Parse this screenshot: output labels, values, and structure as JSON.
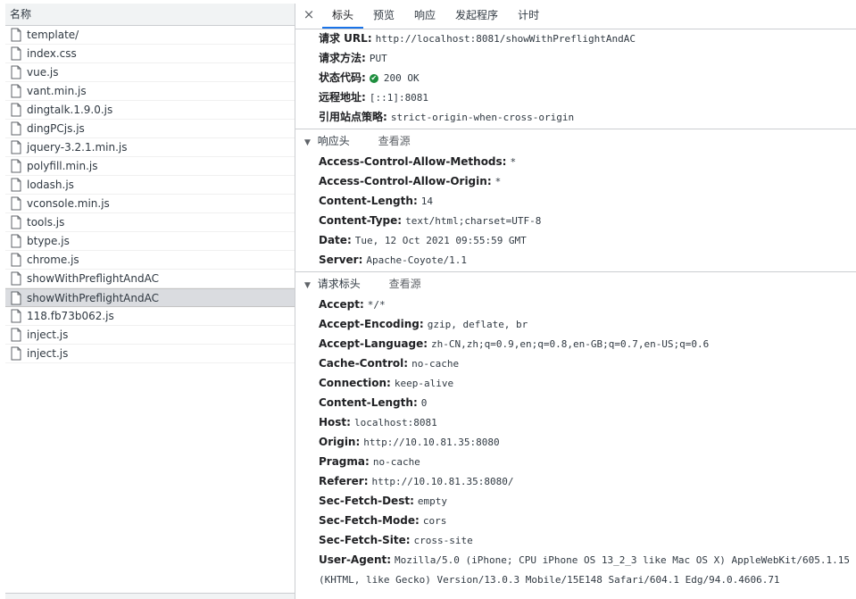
{
  "file_list": {
    "header": "名称",
    "selected_index": 15,
    "items": [
      "template/",
      "index.css",
      "vue.js",
      "vant.min.js",
      "dingtalk.1.9.0.js",
      "dingPCjs.js",
      "jquery-3.2.1.min.js",
      "polyfill.min.js",
      "lodash.js",
      "vconsole.min.js",
      "tools.js",
      "btype.js",
      "chrome.js",
      "showWithPreflightAndAC",
      "showWithPreflightAndAC",
      "118.fb73b062.js",
      "inject.js",
      "inject.js"
    ]
  },
  "tabs": {
    "close_label": "×",
    "items": [
      "标头",
      "预览",
      "响应",
      "发起程序",
      "计时"
    ],
    "active": 0
  },
  "general": [
    {
      "key": "请求 URL",
      "value": "http://localhost:8081/showWithPreflightAndAC"
    },
    {
      "key": "请求方法",
      "value": "PUT"
    },
    {
      "key": "状态代码",
      "value": "200 OK",
      "status_icon": "check-circle-icon",
      "status_color": "#1e8e3e"
    },
    {
      "key": "远程地址",
      "value": "[::1]:8081"
    },
    {
      "key": "引用站点策略",
      "value": "strict-origin-when-cross-origin"
    }
  ],
  "response_headers": {
    "title": "响应头",
    "view_source": "查看源",
    "items": [
      {
        "key": "Access-Control-Allow-Methods",
        "value": "*"
      },
      {
        "key": "Access-Control-Allow-Origin",
        "value": "*"
      },
      {
        "key": "Content-Length",
        "value": "14"
      },
      {
        "key": "Content-Type",
        "value": "text/html;charset=UTF-8"
      },
      {
        "key": "Date",
        "value": "Tue, 12 Oct 2021 09:55:59 GMT"
      },
      {
        "key": "Server",
        "value": "Apache-Coyote/1.1"
      }
    ]
  },
  "request_headers": {
    "title": "请求标头",
    "view_source": "查看源",
    "items": [
      {
        "key": "Accept",
        "value": "*/*"
      },
      {
        "key": "Accept-Encoding",
        "value": "gzip, deflate, br"
      },
      {
        "key": "Accept-Language",
        "value": "zh-CN,zh;q=0.9,en;q=0.8,en-GB;q=0.7,en-US;q=0.6"
      },
      {
        "key": "Cache-Control",
        "value": "no-cache"
      },
      {
        "key": "Connection",
        "value": "keep-alive"
      },
      {
        "key": "Content-Length",
        "value": "0"
      },
      {
        "key": "Host",
        "value": "localhost:8081"
      },
      {
        "key": "Origin",
        "value": "http://10.10.81.35:8080"
      },
      {
        "key": "Pragma",
        "value": "no-cache"
      },
      {
        "key": "Referer",
        "value": "http://10.10.81.35:8080/"
      },
      {
        "key": "Sec-Fetch-Dest",
        "value": "empty"
      },
      {
        "key": "Sec-Fetch-Mode",
        "value": "cors"
      },
      {
        "key": "Sec-Fetch-Site",
        "value": "cross-site"
      },
      {
        "key": "User-Agent",
        "value": "Mozilla/5.0 (iPhone; CPU iPhone OS 13_2_3 like Mac OS X) AppleWebKit/605.1.15",
        "continuation": "(KHTML, like Gecko) Version/13.0.3 Mobile/15E148 Safari/604.1 Edg/94.0.4606.71"
      }
    ]
  },
  "colors": {
    "tab_active": "#1a73e8",
    "selected_row": "#dadce0",
    "border": "#cbcdd1"
  }
}
